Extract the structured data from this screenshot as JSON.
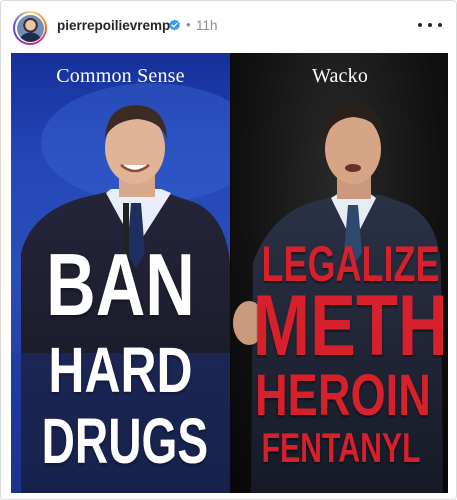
{
  "post": {
    "username": "pierrepoilievremp",
    "verified_icon": "verified-badge-icon",
    "separator": "•",
    "time": "11h",
    "more_icon": "more-options-icon"
  },
  "image": {
    "left": {
      "caption": "Common Sense",
      "lines": [
        "BAN",
        "HARD",
        "DRUGS"
      ]
    },
    "right": {
      "caption": "Wacko",
      "lines": [
        "LEGALIZE",
        "METH",
        "HEROIN",
        "FENTANYL"
      ]
    }
  },
  "colors": {
    "left_bg": "#2447b8",
    "right_bg": "#121212",
    "right_text": "#d6202c",
    "verified": "#3897f0"
  }
}
